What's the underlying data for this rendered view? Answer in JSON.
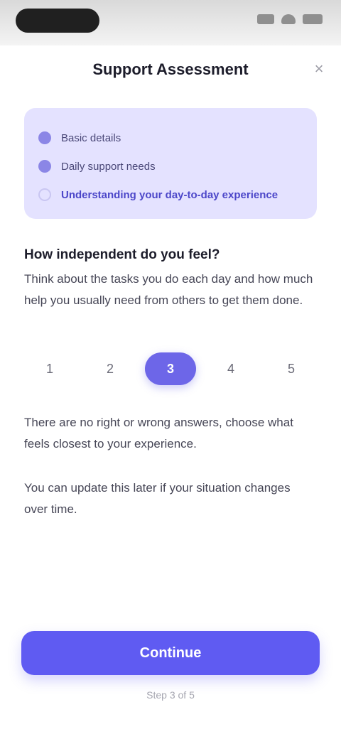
{
  "status_bar": {
    "time": "",
    "icons": [
      "signal-icon",
      "wifi-icon",
      "battery-icon"
    ]
  },
  "header": {
    "title": "Support Assessment",
    "close_icon": "close-icon",
    "close_glyph": "×"
  },
  "progress": {
    "steps": [
      {
        "label": "Basic details",
        "state": "complete"
      },
      {
        "label": "Daily support needs",
        "state": "complete"
      },
      {
        "label": "Understanding your day-to-day experience",
        "state": "current"
      }
    ]
  },
  "question": {
    "heading": "How independent do you feel?",
    "body": "Think about the tasks you do each day and how much help you usually need from others to get them done."
  },
  "rating": {
    "options": [
      "1",
      "2",
      "3",
      "4",
      "5"
    ],
    "selected_index": 2
  },
  "info": {
    "line1": "There are no right or wrong answers, choose what feels closest to your experience.",
    "line2": "You can update this later if your situation changes over time."
  },
  "actions": {
    "continue_label": "Continue"
  },
  "footer": {
    "hint": "Step 3 of 5"
  },
  "colors": {
    "accent": "#5f5bf2",
    "card_bg": "#e4e2ff"
  }
}
